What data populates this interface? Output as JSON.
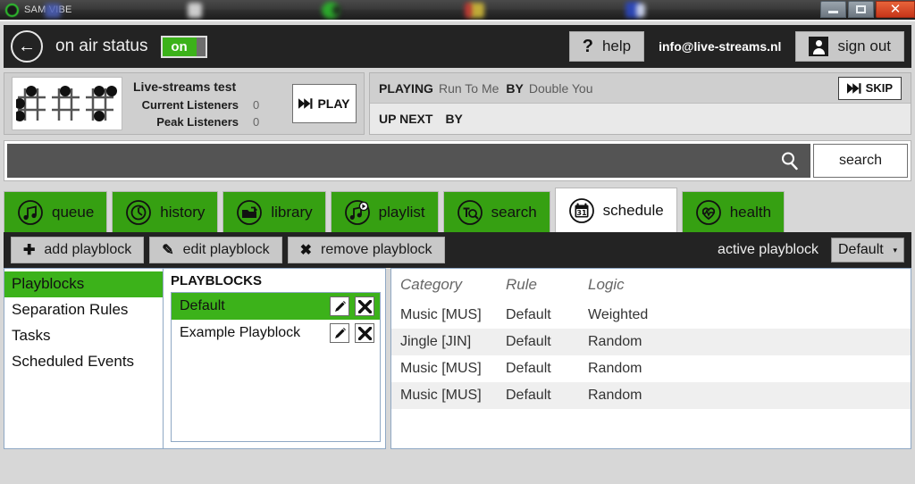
{
  "window": {
    "title": "SAM VIBE",
    "controls": {
      "minimize": "minimize-button",
      "maximize": "maximize-button",
      "close": "✕"
    }
  },
  "header": {
    "back_icon": "←",
    "on_air_label": "on air status",
    "toggle_value": "on",
    "help_label": "help",
    "help_glyph": "?",
    "email": "info@live-streams.nl",
    "sign_out_label": "sign out"
  },
  "station": {
    "name": "Live-streams test",
    "current_listeners_label": "Current Listeners",
    "current_listeners_value": "0",
    "peak_listeners_label": "Peak Listeners",
    "peak_listeners_value": "0",
    "play_label": "PLAY"
  },
  "now_playing": {
    "playing_key": "PLAYING",
    "playing_title": "Run To Me",
    "playing_by_key": "BY",
    "playing_artist": "Double You",
    "skip_label": "SKIP",
    "upnext_key": "UP NEXT",
    "upnext_title": "",
    "upnext_by_key": "BY",
    "upnext_artist": ""
  },
  "search": {
    "value": "",
    "placeholder": "",
    "button_label": "search"
  },
  "tabs": [
    {
      "label": "queue",
      "icon": "music-note-icon",
      "active": false
    },
    {
      "label": "history",
      "icon": "clock-icon",
      "active": false
    },
    {
      "label": "library",
      "icon": "library-folder-icon",
      "active": false
    },
    {
      "label": "playlist",
      "icon": "playlist-note-icon",
      "active": false
    },
    {
      "label": "search",
      "icon": "text-search-icon",
      "active": false
    },
    {
      "label": "schedule",
      "icon": "calendar-31-icon",
      "active": true
    },
    {
      "label": "health",
      "icon": "heartbeat-icon",
      "active": false
    }
  ],
  "toolbar": {
    "add_label": "add playblock",
    "add_glyph": "✚",
    "edit_label": "edit playblock",
    "edit_glyph": "✎",
    "remove_label": "remove playblock",
    "remove_glyph": "✖",
    "active_playblock_label": "active playblock",
    "active_playblock_value": "Default",
    "caret": "▾"
  },
  "sidebar": {
    "items": [
      {
        "label": "Playblocks",
        "selected": true
      },
      {
        "label": "Separation Rules",
        "selected": false
      },
      {
        "label": "Tasks",
        "selected": false
      },
      {
        "label": "Scheduled Events",
        "selected": false
      }
    ]
  },
  "playblocks_panel": {
    "title": "PLAYBLOCKS",
    "items": [
      {
        "name": "Default",
        "selected": true
      },
      {
        "name": "Example Playblock",
        "selected": false
      }
    ]
  },
  "grid": {
    "columns": [
      "Category",
      "Rule",
      "Logic"
    ],
    "rows": [
      [
        "Music [MUS]",
        "Default",
        "Weighted"
      ],
      [
        "Jingle [JIN]",
        "Default",
        "Random"
      ],
      [
        "Music [MUS]",
        "Default",
        "Random"
      ],
      [
        "Music [MUS]",
        "Default",
        "Random"
      ]
    ]
  },
  "colors": {
    "brand_green": "#36a012",
    "select_green": "#3cb21a",
    "dark_bar": "#232323",
    "page_bg": "#d7d7d7"
  }
}
